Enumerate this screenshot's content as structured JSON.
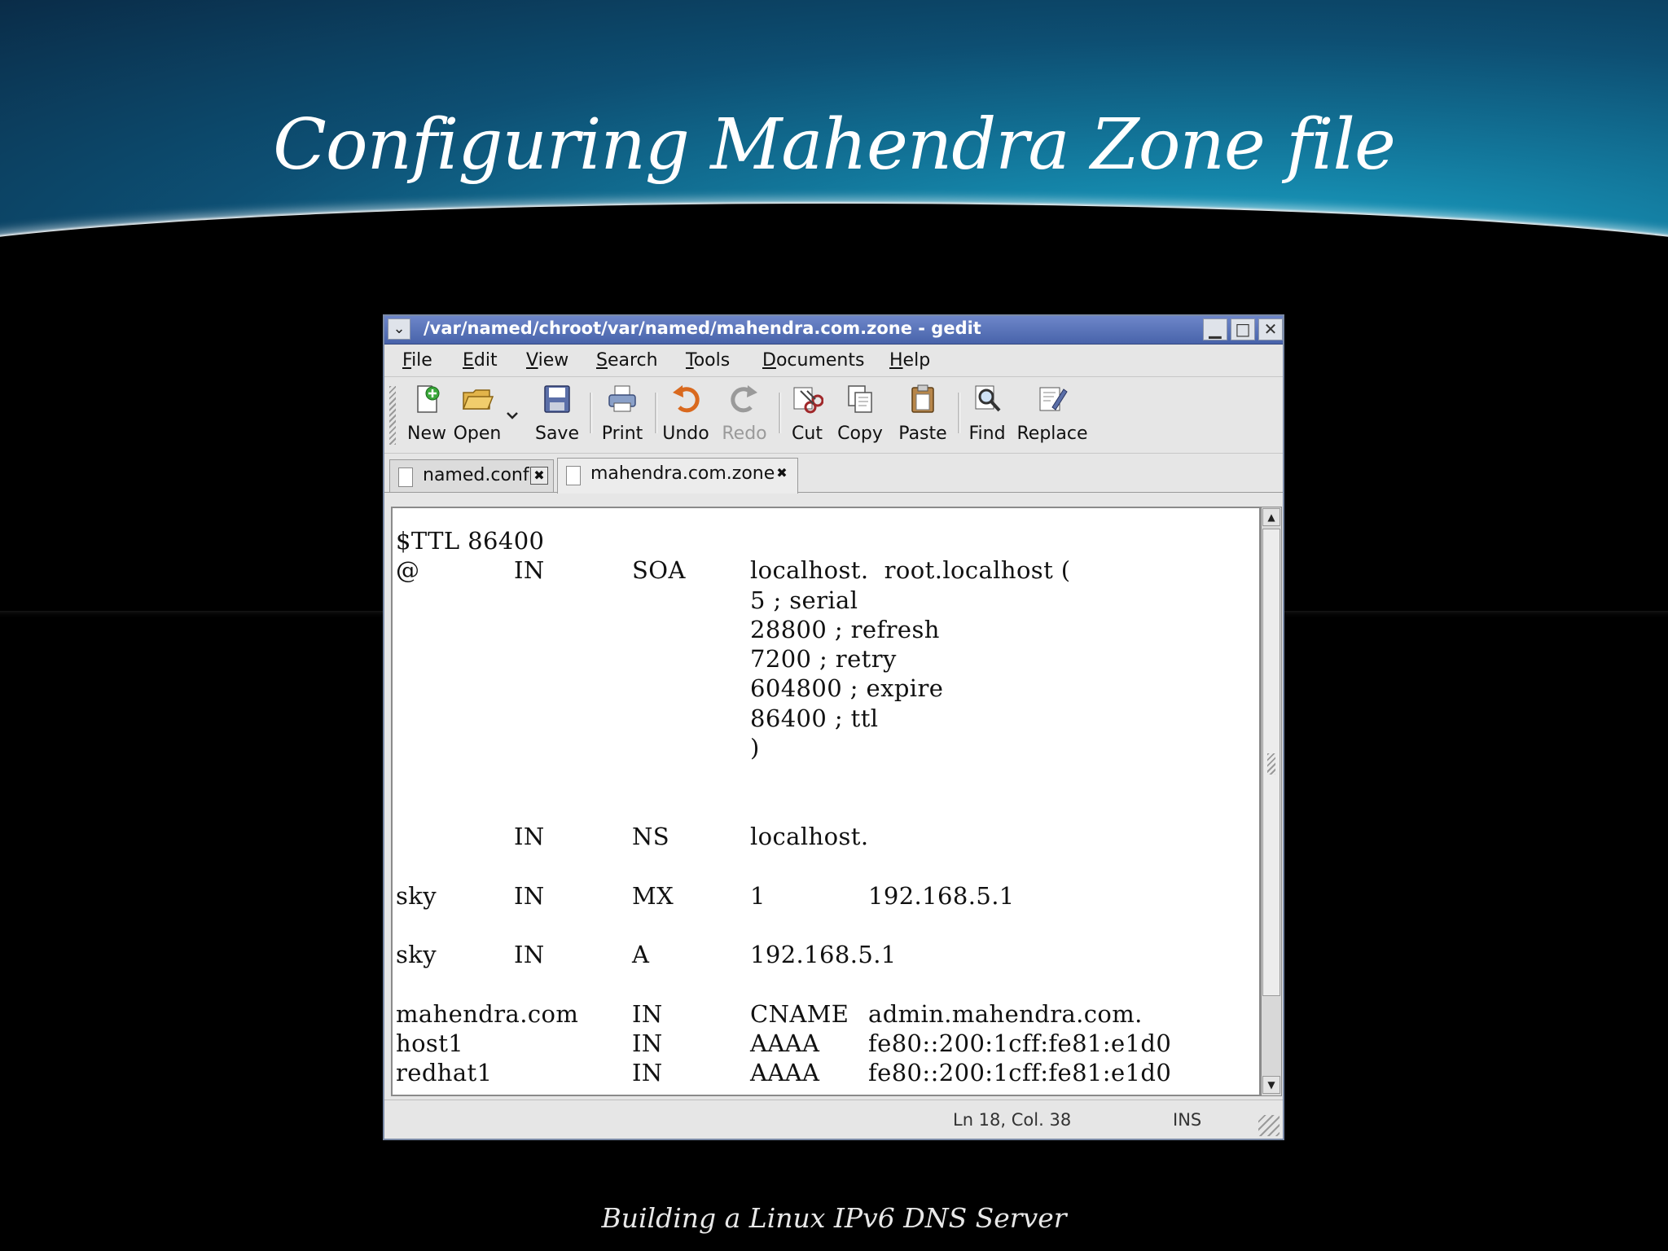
{
  "slide": {
    "title": "Configuring Mahendra Zone file",
    "footer": "Building a Linux IPv6 DNS Server"
  },
  "window": {
    "title": "/var/named/chroot/var/named/mahendra.com.zone - gedit",
    "menu_button_glyph": "⌄",
    "minimize_glyph": "▁",
    "maximize_glyph": "□",
    "close_glyph": "✕"
  },
  "menu": [
    {
      "key": "file",
      "accel": "F",
      "rest": "ile"
    },
    {
      "key": "edit",
      "accel": "E",
      "rest": "dit"
    },
    {
      "key": "view",
      "accel": "V",
      "rest": "iew"
    },
    {
      "key": "search",
      "accel": "S",
      "rest": "earch"
    },
    {
      "key": "tools",
      "accel": "T",
      "rest": "ools"
    },
    {
      "key": "documents",
      "accel": "D",
      "rest": "ocuments"
    },
    {
      "key": "help",
      "accel": "H",
      "rest": "elp"
    }
  ],
  "toolbar": {
    "new": "New",
    "open": "Open",
    "save": "Save",
    "print": "Print",
    "undo": "Undo",
    "redo": "Redo",
    "cut": "Cut",
    "copy": "Copy",
    "paste": "Paste",
    "find": "Find",
    "replace": "Replace"
  },
  "tabs": [
    {
      "label": "named.conf",
      "active": false,
      "close_glyph": "✖"
    },
    {
      "label": "mahendra.com.zone",
      "active": true,
      "close_glyph": "✖"
    }
  ],
  "editor": {
    "lines": [
      [
        "$TTL 86400"
      ],
      [
        "@",
        "IN",
        "SOA",
        "localhost.  root.localhost ("
      ],
      [
        "",
        "",
        "",
        "5 ; serial"
      ],
      [
        "",
        "",
        "",
        "28800 ; refresh"
      ],
      [
        "",
        "",
        "",
        "7200 ; retry"
      ],
      [
        "",
        "",
        "",
        "604800 ; expire"
      ],
      [
        "",
        "",
        "",
        "86400 ; ttl"
      ],
      [
        "",
        "",
        "",
        ")"
      ],
      [],
      [],
      [
        "",
        "IN",
        "NS",
        "localhost."
      ],
      [],
      [
        "sky",
        "IN",
        "MX",
        "1",
        "192.168.5.1"
      ],
      [],
      [
        "sky",
        "IN",
        "A",
        "192.168.5.1"
      ],
      [],
      [
        "mahendra.com",
        "",
        "IN",
        "CNAME",
        "admin.mahendra.com."
      ],
      [
        "host1",
        "",
        "IN",
        "AAAA",
        "fe80::200:1cff:fe81:e1d0"
      ],
      [
        "redhat1",
        "",
        "IN",
        "AAAA",
        "fe80::200:1cff:fe81:e1d0"
      ]
    ]
  },
  "status": {
    "position": "Ln 18, Col. 38",
    "mode": "INS"
  }
}
